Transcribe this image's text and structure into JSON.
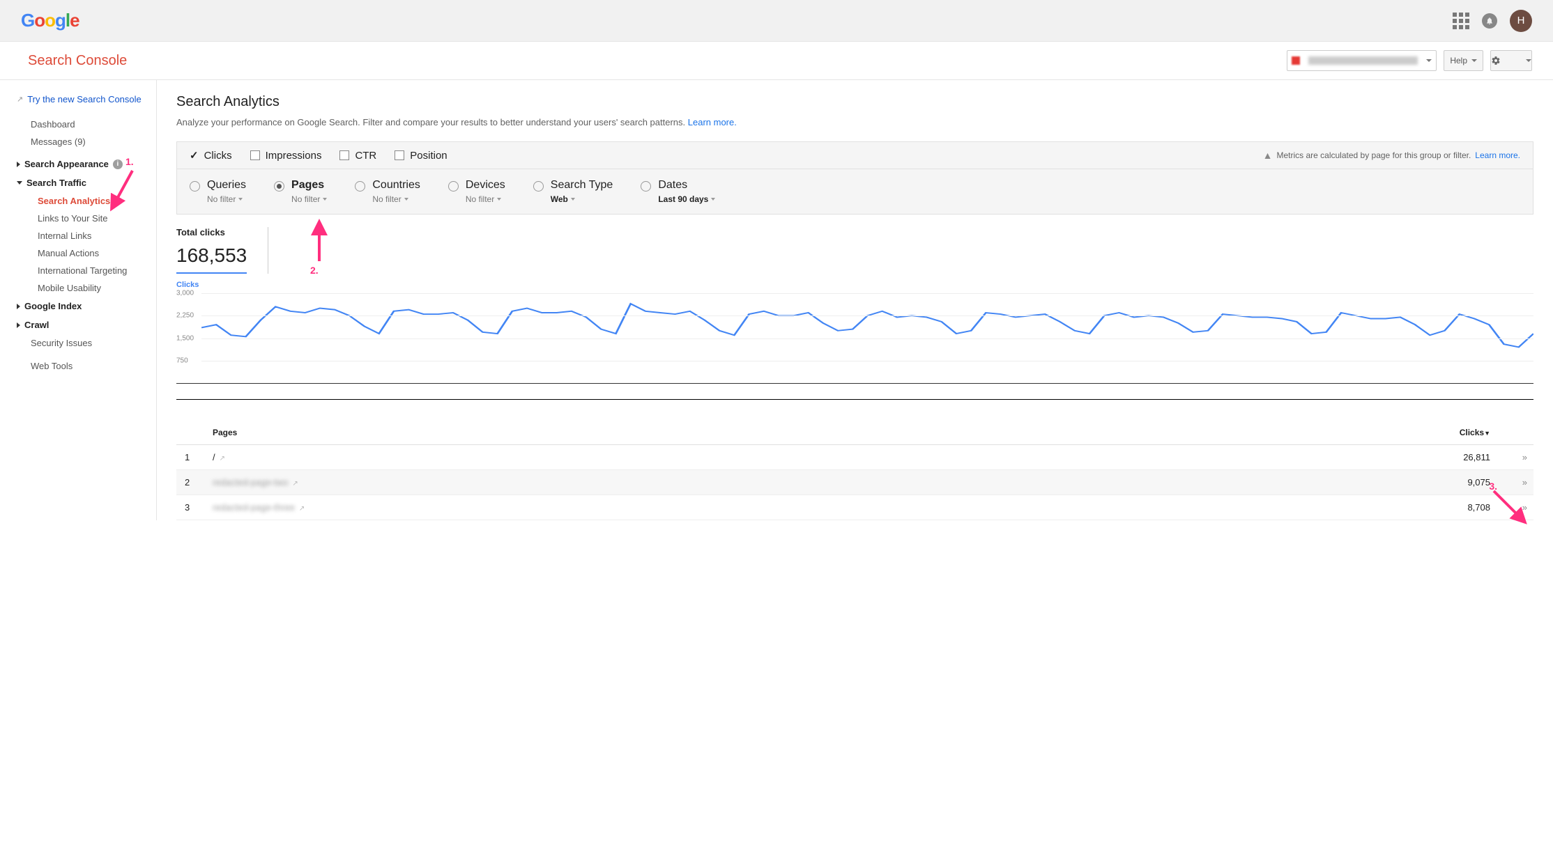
{
  "topbar": {
    "logo": "Google",
    "avatar_initial": "H"
  },
  "subheader": {
    "title": "Search Console",
    "help_label": "Help"
  },
  "sidebar": {
    "try_new": "Try the new Search Console",
    "dashboard": "Dashboard",
    "messages": "Messages (9)",
    "search_appearance": "Search Appearance",
    "search_traffic": "Search Traffic",
    "traffic_items": {
      "analytics": "Search Analytics",
      "links": "Links to Your Site",
      "internal": "Internal Links",
      "manual": "Manual Actions",
      "intl": "International Targeting",
      "mobile": "Mobile Usability"
    },
    "google_index": "Google Index",
    "crawl": "Crawl",
    "security": "Security Issues",
    "webtools": "Web Tools"
  },
  "page": {
    "title": "Search Analytics",
    "desc": "Analyze your performance on Google Search. Filter and compare your results to better understand your users' search patterns. ",
    "learn_more": "Learn more."
  },
  "metrics": {
    "clicks": "Clicks",
    "impressions": "Impressions",
    "ctr": "CTR",
    "position": "Position",
    "note": "Metrics are calculated by page for this group or filter. ",
    "note_link": "Learn more."
  },
  "dimensions": {
    "queries": {
      "label": "Queries",
      "filter": "No filter"
    },
    "pages": {
      "label": "Pages",
      "filter": "No filter"
    },
    "countries": {
      "label": "Countries",
      "filter": "No filter"
    },
    "devices": {
      "label": "Devices",
      "filter": "No filter"
    },
    "search_type": {
      "label": "Search Type",
      "filter": "Web"
    },
    "dates": {
      "label": "Dates",
      "filter": "Last 90 days"
    }
  },
  "totals": {
    "label": "Total clicks",
    "value": "168,553"
  },
  "chart_title": "Clicks",
  "chart_data": {
    "type": "line",
    "ylabel": "Clicks",
    "ylim": [
      0,
      3000
    ],
    "yticks": [
      750,
      1500,
      2250,
      3000
    ],
    "values": [
      1850,
      1950,
      1600,
      1550,
      2100,
      2550,
      2400,
      2350,
      2500,
      2450,
      2250,
      1900,
      1650,
      2400,
      2450,
      2300,
      2300,
      2350,
      2100,
      1700,
      1650,
      2400,
      2500,
      2350,
      2350,
      2400,
      2200,
      1800,
      1650,
      2650,
      2400,
      2350,
      2300,
      2400,
      2100,
      1750,
      1600,
      2300,
      2400,
      2250,
      2250,
      2350,
      2000,
      1750,
      1800,
      2250,
      2400,
      2200,
      2250,
      2200,
      2050,
      1650,
      1750,
      2350,
      2300,
      2200,
      2250,
      2300,
      2050,
      1750,
      1650,
      2250,
      2350,
      2200,
      2250,
      2200,
      2000,
      1700,
      1750,
      2300,
      2250,
      2200,
      2200,
      2150,
      2050,
      1650,
      1700,
      2350,
      2250,
      2150,
      2150,
      2200,
      1950,
      1600,
      1750,
      2300,
      2150,
      1950,
      1300,
      1200,
      1650
    ]
  },
  "table": {
    "col_pages": "Pages",
    "col_clicks": "Clicks",
    "rows": [
      {
        "idx": "1",
        "page": "/",
        "clicks": "26,811"
      },
      {
        "idx": "2",
        "page": "redacted-page-two",
        "clicks": "9,075"
      },
      {
        "idx": "3",
        "page": "redacted-page-three",
        "clicks": "8,708"
      }
    ]
  },
  "annotations": {
    "a1": "1.",
    "a2": "2.",
    "a3": "3."
  }
}
